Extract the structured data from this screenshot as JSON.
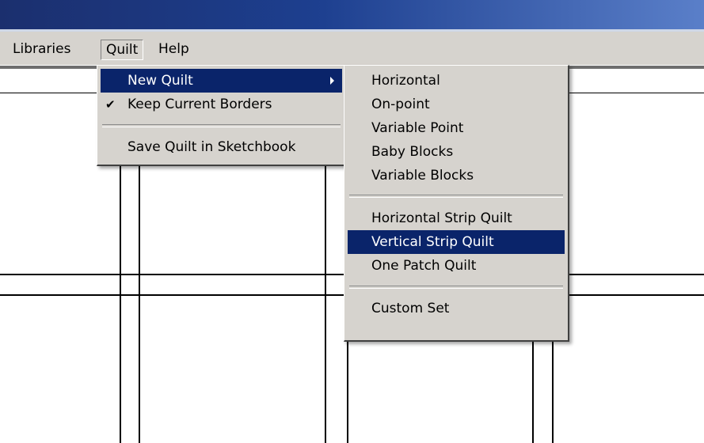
{
  "menubar": {
    "items": [
      {
        "label": "Libraries"
      },
      {
        "label": "Quilt"
      },
      {
        "label": "Help"
      }
    ]
  },
  "quilt_menu": {
    "items": [
      {
        "label": "New Quilt",
        "has_submenu": true,
        "highlighted": true
      },
      {
        "label": "Keep Current Borders",
        "checked": true
      },
      {
        "label": "Save Quilt in Sketchbook"
      }
    ]
  },
  "new_quilt_submenu": {
    "items": [
      {
        "label": "Horizontal"
      },
      {
        "label": "On-point"
      },
      {
        "label": "Variable Point"
      },
      {
        "label": "Baby Blocks"
      },
      {
        "label": "Variable Blocks"
      },
      {
        "label": "Horizontal Strip Quilt"
      },
      {
        "label": "Vertical Strip Quilt",
        "highlighted": true
      },
      {
        "label": "One Patch Quilt"
      },
      {
        "label": "Custom Set"
      }
    ]
  },
  "colors": {
    "menu_bg": "#d6d3ce",
    "highlight": "#0a246a",
    "title_bar": "#1d3f8f"
  }
}
